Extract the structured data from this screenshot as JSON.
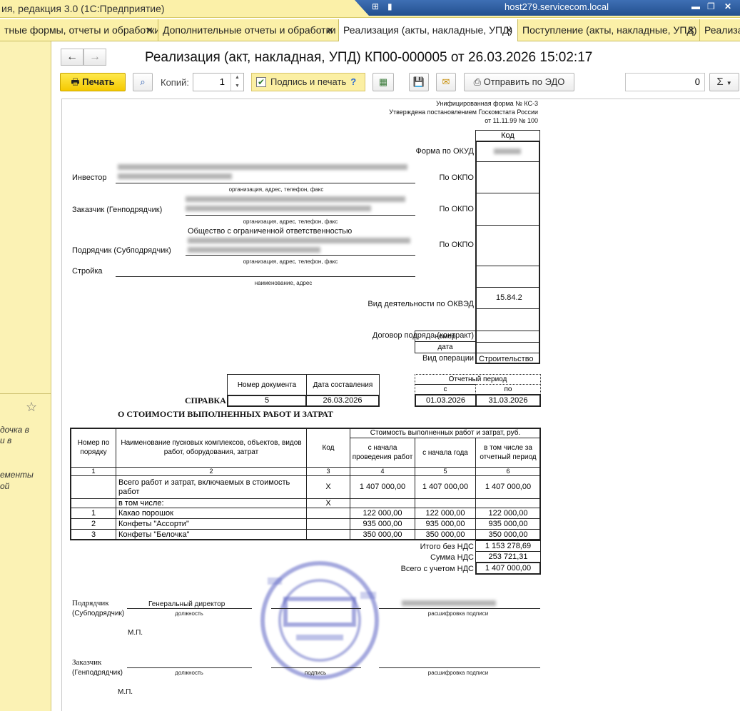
{
  "titlebar": {
    "app_title": "ия, редакция 3.0  (1С:Предприятие)",
    "host": "host279.servicecom.local"
  },
  "tabs": [
    {
      "label": "тные формы, отчеты и обработки"
    },
    {
      "label": "Дополнительные отчеты и обработки"
    },
    {
      "label": "Реализация (акты, накладные, УПД)"
    },
    {
      "label": "Поступление (акты, накладные, УПД)"
    },
    {
      "label": "Реализа"
    }
  ],
  "sidebar": {
    "text_lines": [
      "дочка в",
      "и в",
      "ементы",
      "ой"
    ]
  },
  "document": {
    "title": "Реализация (акт, накладная, УПД) КП00-000005 от 26.03.2026 15:02:17"
  },
  "toolbar": {
    "print_label": "Печать",
    "copies_label": "Копий:",
    "copies_value": "1",
    "sign_label": "Подпись и печать",
    "help_mark": "?",
    "send_edo_label": "Отправить по ЭДО",
    "sum_value": "0",
    "sigma": "Σ"
  },
  "form": {
    "header_lines": [
      "Унифицированная форма № КС-3",
      "Утверждена постановлением  Госкомстата России",
      "от 11.11.99 № 100"
    ],
    "code_header": "Код",
    "okud_label": "Форма по ОКУД",
    "okpo_label": "По ОКПО",
    "investor_label": "Инвестор",
    "customer_label": "Заказчик (Генподрядчик)",
    "contractor_label": "Подрядчик (Субподрядчик)",
    "contractor_org": "Общество с ограниченной ответственностью",
    "site_label": "Стройка",
    "org_caption": "организация, адрес, телефон, факс",
    "site_caption": "наименование, адрес",
    "okved_label": "Вид деятельности по ОКВЭД",
    "okved_value": "15.84.2",
    "contract_label": "Договор подряда (контракт)",
    "contract_number_label": "номер",
    "contract_date_label": "дата",
    "operation_label": "Вид операции",
    "operation_value": "Строительство",
    "docnum_header": "Номер документа",
    "docdate_header": "Дата составления",
    "period_header": "Отчетный период",
    "period_from_label": "с",
    "period_to_label": "по",
    "spravka_label": "СПРАВКА",
    "docnum_value": "5",
    "docdate_value": "26.03.2026",
    "period_from": "01.03.2026",
    "period_to": "31.03.2026",
    "subtitle": "О СТОИМОСТИ ВЫПОЛНЕННЫХ РАБОТ И ЗАТРАТ"
  },
  "table": {
    "h_num": "Номер по порядку",
    "h_name": "Наименование пусковых комплексов, объектов, видов работ, оборудования, затрат",
    "h_code": "Код",
    "h_cost": "Стоимость выполненных работ и затрат, руб.",
    "h_c4": "с начала проведения работ",
    "h_c5": "с начала года",
    "h_c6": "в том числе за отчетный период",
    "colnums": [
      "1",
      "2",
      "3",
      "4",
      "5",
      "6"
    ],
    "total_label": "Всего работ и затрат, включаемых в стоимость работ",
    "total_code": "X",
    "total_c4": "1 407 000,00",
    "total_c5": "1 407 000,00",
    "total_c6": "1 407 000,00",
    "incl_label": "в том числе:",
    "incl_code": "X",
    "rows": [
      {
        "num": "1",
        "name": "Какао порошок",
        "c4": "122 000,00",
        "c5": "122 000,00",
        "c6": "122 000,00"
      },
      {
        "num": "2",
        "name": "Конфеты \"Ассорти\"",
        "c4": "935 000,00",
        "c5": "935 000,00",
        "c6": "935 000,00"
      },
      {
        "num": "3",
        "name": "Конфеты \"Белочка\"",
        "c4": "350 000,00",
        "c5": "350 000,00",
        "c6": "350 000,00"
      }
    ],
    "subtotal_label": "Итого без НДС",
    "subtotal_value": "1 153 278,69",
    "vat_label": "Сумма НДС",
    "vat_value": "253 721,31",
    "grand_label": "Всего с учетом НДС",
    "grand_value": "1 407 000,00"
  },
  "signatures": {
    "contractor_label1": "Подрядчик",
    "contractor_label2": "(Субподрядчик)",
    "contractor_position": "Генеральный директор",
    "position_caption": "должность",
    "signature_caption": "подпись",
    "decode_caption": "расшифровка подписи",
    "mp_label": "М.П.",
    "customer_label1": "Заказчик",
    "customer_label2": "(Генподрядчик)"
  }
}
